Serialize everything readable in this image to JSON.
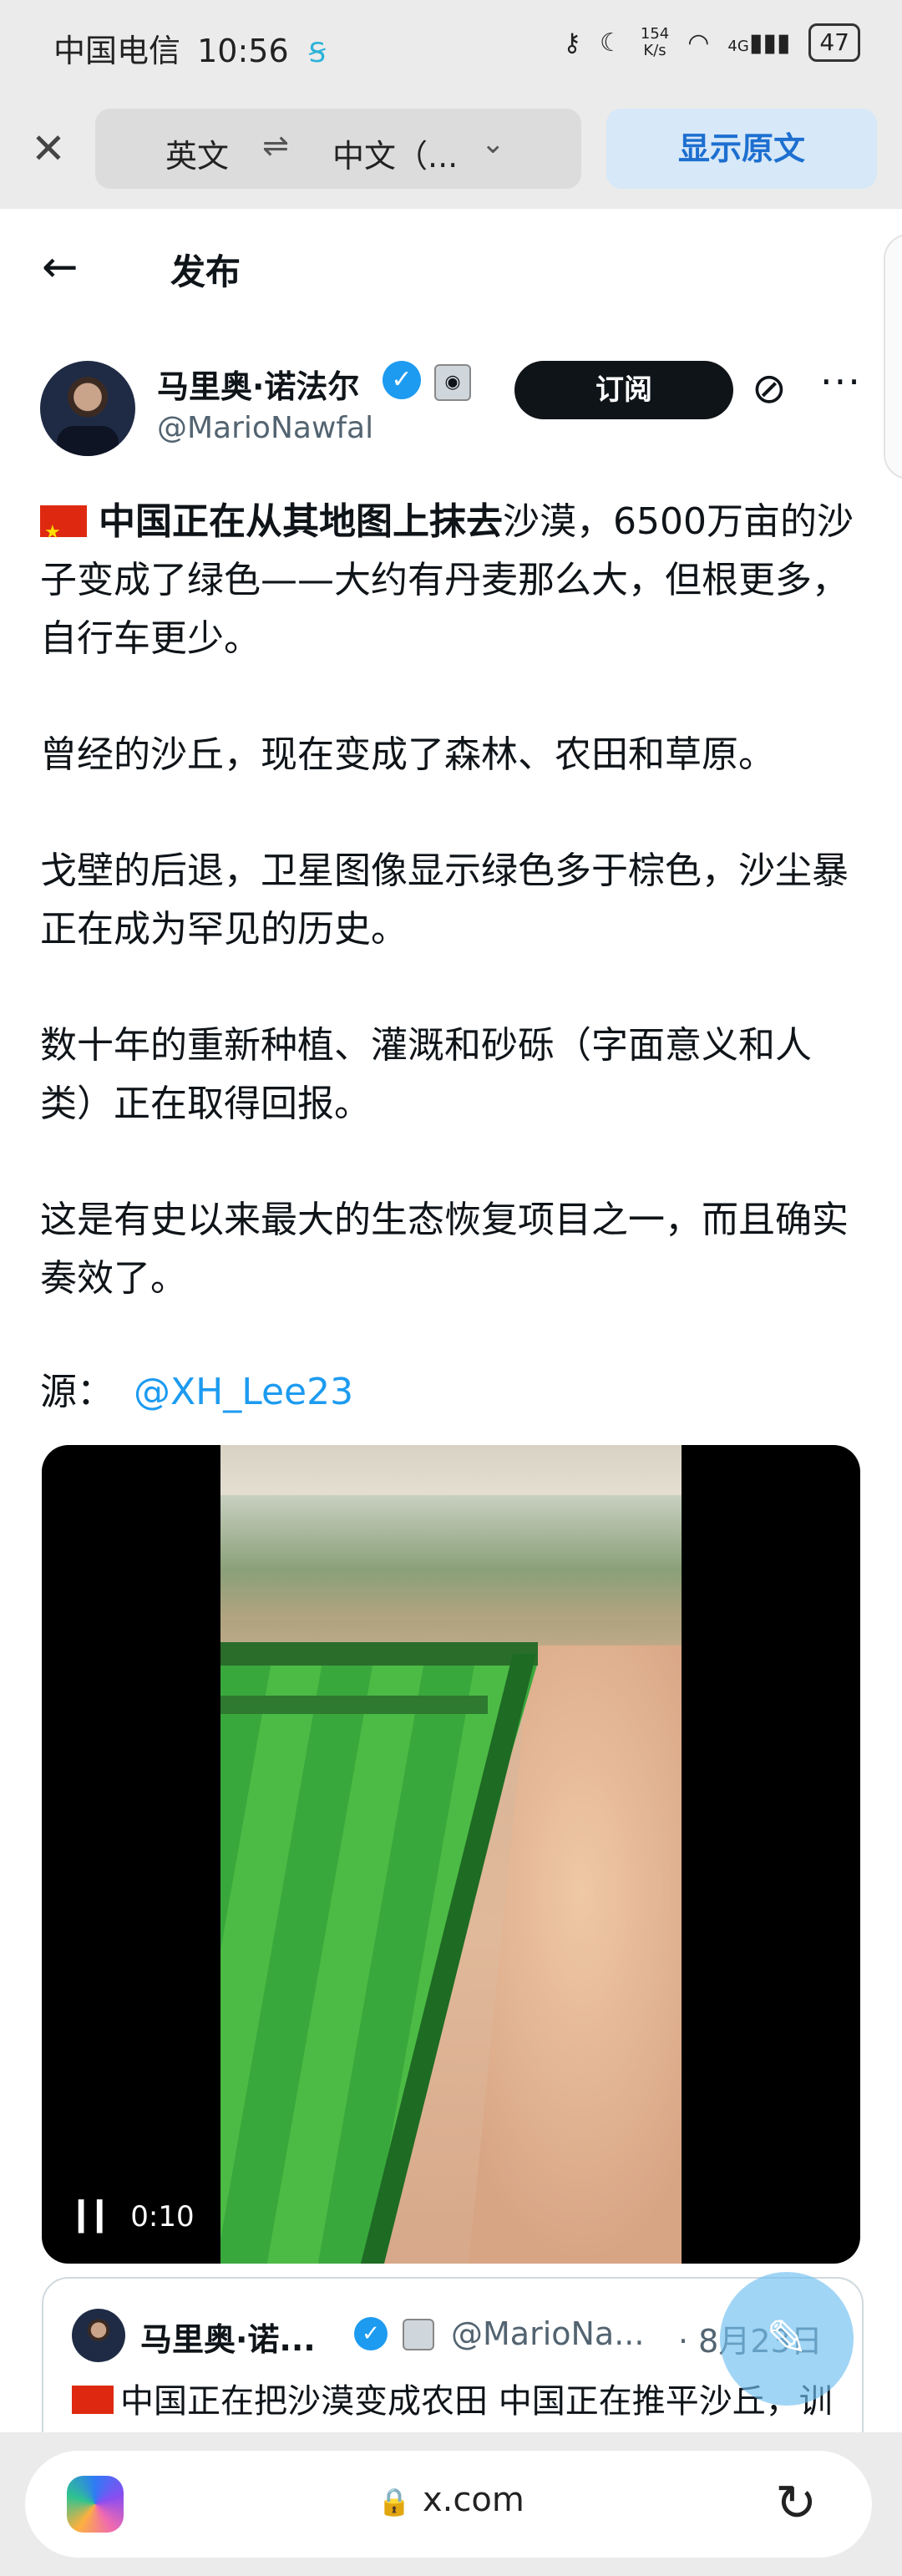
{
  "status_bar": {
    "carrier": "中国电信",
    "time": "10:56",
    "net_speed": "154\nK/s",
    "network": "4G",
    "battery": "47"
  },
  "translate_bar": {
    "source_lang": "英文",
    "swap_icon": "⇌",
    "target_lang": "中文（...",
    "show_original": "显示原文"
  },
  "header": {
    "title": "发布"
  },
  "author": {
    "name": "马里奥·诺法尔",
    "handle": "@MarioNawfal",
    "subscribe_label": "订阅"
  },
  "post": {
    "p1_bold": "中国正在从其地图上抹去",
    "p1_rest": "沙漠，6500万亩的沙子变成了绿色——大约有丹麦那么大，但根更多，自行车更少。",
    "p2": "曾经的沙丘，现在变成了森林、农田和草原。",
    "p3": "戈壁的后退，卫星图像显示绿色多于棕色，沙尘暴正在成为罕见的历史。",
    "p4": "数十年的重新种植、灌溉和砂砾（字面意义和人类）正在取得回报。",
    "p5": "这是有史以来最大的生态恢复项目之一，而且确实奏效了。",
    "source_label": "源：",
    "source_link": "@XH_Lee23"
  },
  "video": {
    "time": "0:10"
  },
  "quote": {
    "name": "马里奥·诺...",
    "handle": "@MarioNa...",
    "date": "· 8月23日",
    "text": "中国正在把沙漠变成农田 中国正在推平沙丘，训练播撒沙子路过时的作品，然后使用种植"
  },
  "browser": {
    "url": "x.com"
  },
  "colors": {
    "accent": "#1d9bf0",
    "show_original_bg": "#d7e8f8",
    "subscribe_bg": "#0f1419"
  }
}
